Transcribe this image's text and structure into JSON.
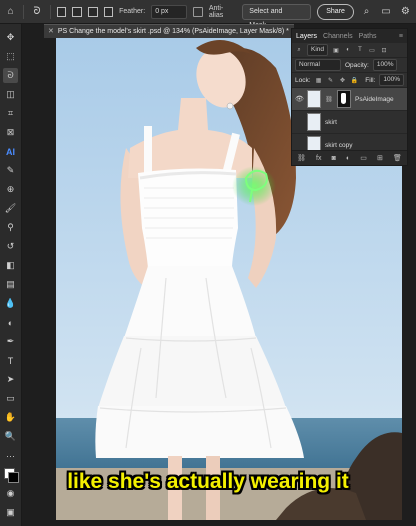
{
  "options_bar": {
    "feather_label": "Feather:",
    "feather_value": "0 px",
    "anti_alias_label": "Anti-alias",
    "select_and_mask_label": "Select and Mask...",
    "share_label": "Share"
  },
  "document": {
    "tab_title": "PS Change the model's skirt .psd @ 134% (PsAideImage, Layer Mask/8) *"
  },
  "layers_panel": {
    "tabs": [
      "Layers",
      "Channels",
      "Paths"
    ],
    "kind_label": "Kind",
    "blend_mode": "Normal",
    "opacity_label": "Opacity:",
    "opacity_value": "100%",
    "lock_label": "Lock:",
    "fill_label": "Fill:",
    "fill_value": "100%",
    "layers": [
      {
        "name": "PsAideImage",
        "selected": true
      },
      {
        "name": "skirt",
        "selected": false
      },
      {
        "name": "skirt copy",
        "selected": false
      }
    ]
  },
  "caption": {
    "text": "like she's actually wearing it"
  }
}
